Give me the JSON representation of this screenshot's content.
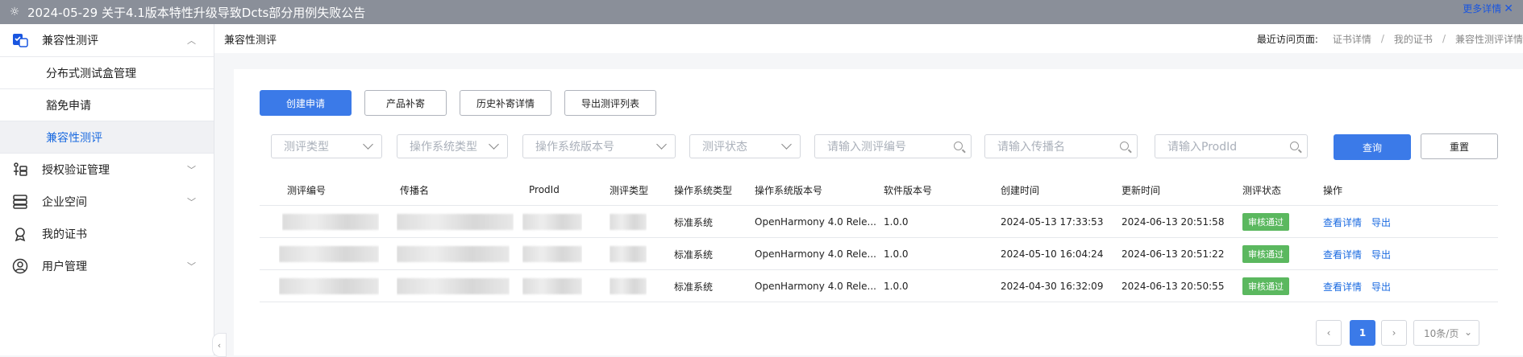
{
  "banner": {
    "icon": "sun-icon",
    "title": "2024-05-29 关于4.1版本特性升级导致Dcts部分用例失败公告",
    "more_label": "更多详情"
  },
  "sidebar": {
    "groups": [
      {
        "label": "兼容性测评",
        "icon": "compat-icon",
        "expanded": true
      },
      {
        "label": "授权验证管理",
        "icon": "auth-icon"
      },
      {
        "label": "企业空间",
        "icon": "enterprise-icon"
      },
      {
        "label": "我的证书",
        "icon": "certificate-icon"
      },
      {
        "label": "用户管理",
        "icon": "user-icon"
      }
    ],
    "sub_items": [
      "分布式测试盒管理",
      "豁免申请",
      "兼容性测评"
    ]
  },
  "header": {
    "page_title": "兼容性测评",
    "recent_label": "最近访问页面:",
    "recent_links": [
      "证书详情",
      "我的证书",
      "兼容性测评详情"
    ]
  },
  "toolbar": {
    "create": "创建申请",
    "supplement": "产品补寄",
    "history": "历史补寄详情",
    "export_list": "导出测评列表"
  },
  "filters": {
    "selects": [
      "测评类型",
      "操作系统类型",
      "操作系统版本号",
      "测评状态"
    ],
    "inputs": [
      "请输入测评编号",
      "请输入传播名",
      "请输入ProdId"
    ],
    "query": "查询",
    "reset": "重置"
  },
  "table": {
    "columns": [
      "测评编号",
      "传播名",
      "ProdId",
      "测评类型",
      "操作系统类型",
      "操作系统版本号",
      "软件版本号",
      "创建时间",
      "更新时间",
      "测评状态",
      "操作"
    ],
    "rows": [
      {
        "os_type": "标准系统",
        "os_version": "OpenHarmony 4.0 Rele...",
        "sw_version": "1.0.0",
        "created": "2024-05-13 17:33:53",
        "updated": "2024-06-13 20:51:58",
        "status": "审核通过",
        "actions": [
          "查看详情",
          "导出"
        ]
      },
      {
        "os_type": "标准系统",
        "os_version": "OpenHarmony 4.0 Rele...",
        "sw_version": "1.0.0",
        "created": "2024-05-10 16:04:24",
        "updated": "2024-06-13 20:51:22",
        "status": "审核通过",
        "actions": [
          "查看详情",
          "导出"
        ]
      },
      {
        "os_type": "标准系统",
        "os_version": "OpenHarmony 4.0 Rele...",
        "sw_version": "1.0.0",
        "created": "2024-04-30 16:32:09",
        "updated": "2024-06-13 20:50:55",
        "status": "审核通过",
        "actions": [
          "查看详情",
          "导出"
        ]
      }
    ]
  },
  "pagination": {
    "prev": "‹",
    "current": "1",
    "next": "›",
    "page_size": "10条/页"
  },
  "colors": {
    "primary": "#3b7ae8",
    "success": "#5bb85f",
    "banner": "#8a8f99"
  }
}
